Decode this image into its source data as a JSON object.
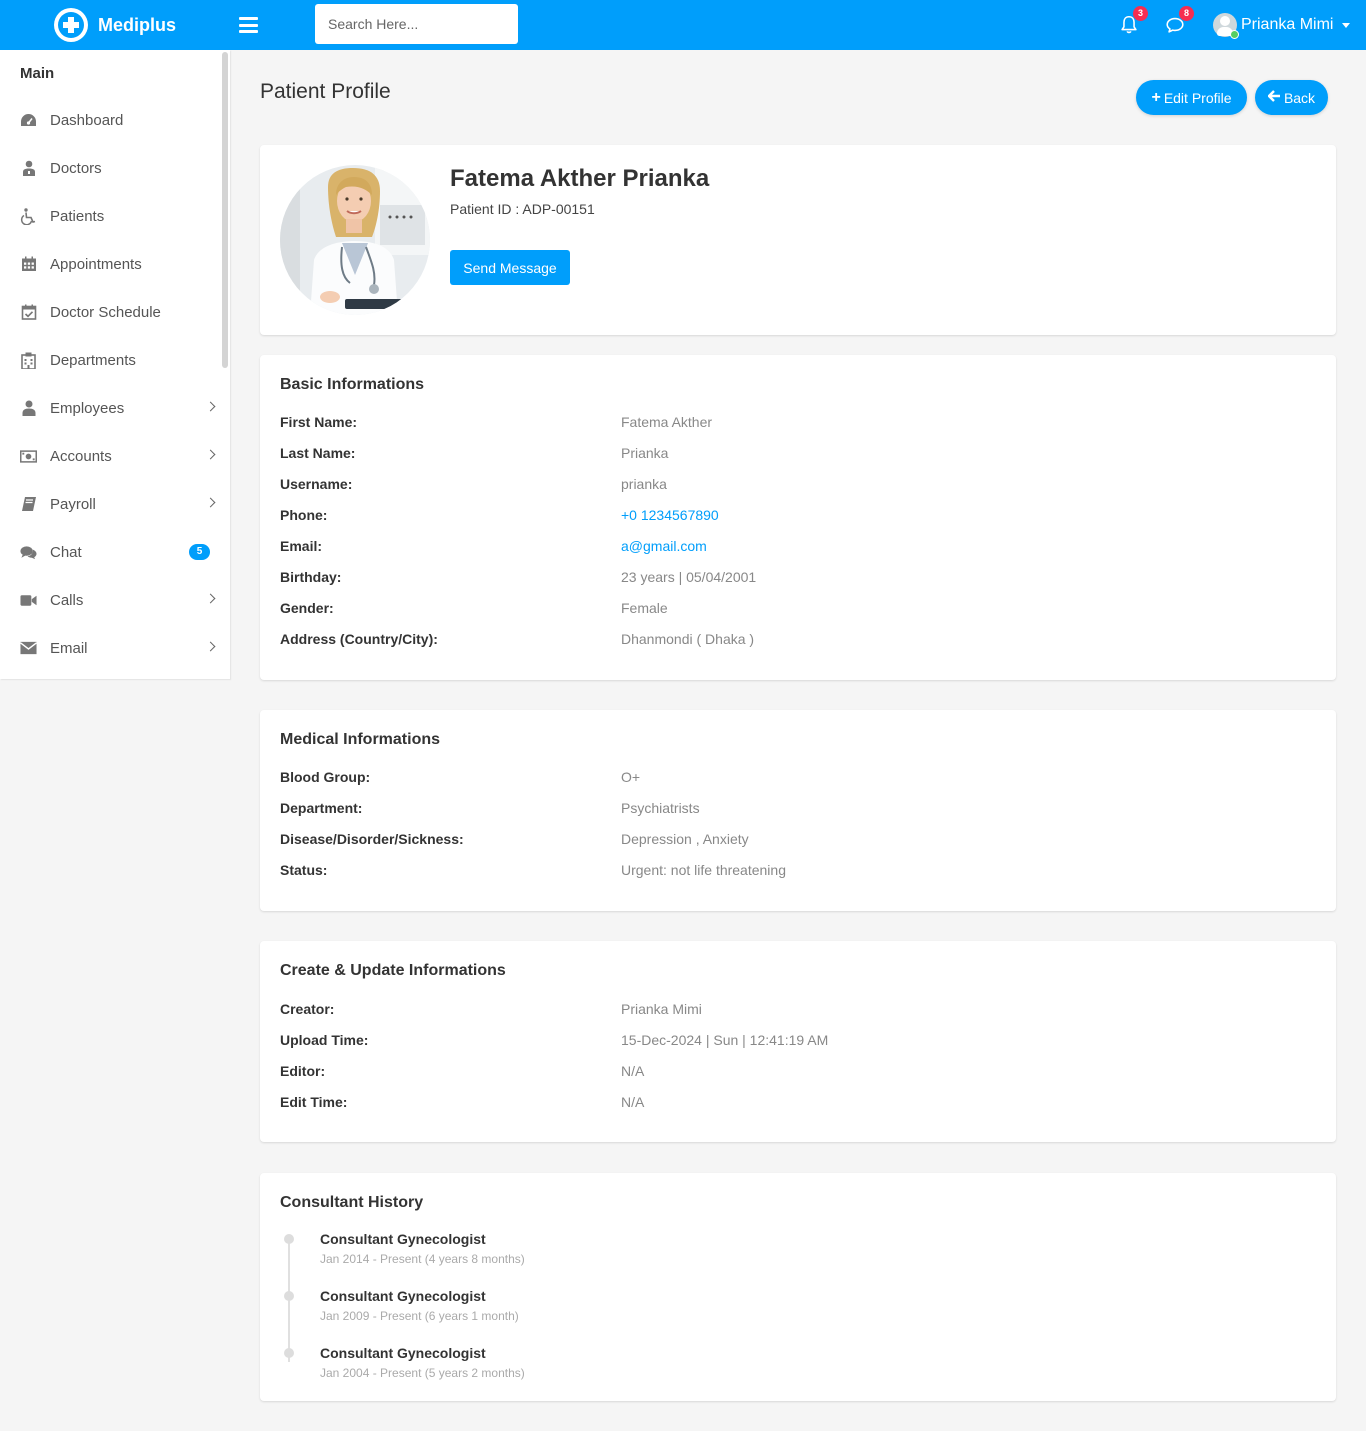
{
  "header": {
    "brand": "Mediplus",
    "search_placeholder": "Search Here...",
    "notifications_count": "3",
    "messages_count": "8",
    "user_name": "Prianka Mimi"
  },
  "sidebar": {
    "title": "Main",
    "items": [
      {
        "label": "Dashboard",
        "icon": "dashboard-icon"
      },
      {
        "label": "Doctors",
        "icon": "doctor-icon"
      },
      {
        "label": "Patients",
        "icon": "wheelchair-icon"
      },
      {
        "label": "Appointments",
        "icon": "calendar-icon"
      },
      {
        "label": "Doctor Schedule",
        "icon": "calendar-check-icon"
      },
      {
        "label": "Departments",
        "icon": "hospital-icon"
      },
      {
        "label": "Employees",
        "icon": "user-icon",
        "has_submenu": true
      },
      {
        "label": "Accounts",
        "icon": "money-icon",
        "has_submenu": true
      },
      {
        "label": "Payroll",
        "icon": "book-icon",
        "has_submenu": true
      },
      {
        "label": "Chat",
        "icon": "comments-icon",
        "badge": "5"
      },
      {
        "label": "Calls",
        "icon": "video-camera-icon",
        "has_submenu": true
      },
      {
        "label": "Email",
        "icon": "envelope-icon",
        "has_submenu": true
      }
    ]
  },
  "page": {
    "title": "Patient Profile",
    "edit_button": "Edit Profile",
    "back_button": "Back"
  },
  "profile": {
    "name": "Fatema Akther Prianka",
    "patient_id": "Patient ID : ADP-00151",
    "send_message": "Send Message"
  },
  "basic": {
    "title": "Basic Informations",
    "rows": [
      {
        "label": "First Name:",
        "value": "Fatema Akther"
      },
      {
        "label": "Last Name:",
        "value": "Prianka"
      },
      {
        "label": "Username:",
        "value": "prianka"
      },
      {
        "label": "Phone:",
        "value": "+0 1234567890"
      },
      {
        "label": "Email:",
        "value": "a@gmail.com"
      },
      {
        "label": "Birthday:",
        "value": "23 years | 05/04/2001"
      },
      {
        "label": "Gender:",
        "value": "Female"
      },
      {
        "label": "Address (Country/City):",
        "value": "Dhanmondi ( Dhaka )"
      }
    ]
  },
  "medical": {
    "title": "Medical Informations",
    "rows": [
      {
        "label": "Blood Group:",
        "value": "O+"
      },
      {
        "label": "Department:",
        "value": "Psychiatrists"
      },
      {
        "label": "Disease/Disorder/Sickness:",
        "value": "Depression , Anxiety"
      },
      {
        "label": "Status:",
        "value": "Urgent: not life threatening"
      }
    ]
  },
  "audit": {
    "title": "Create & Update Informations",
    "rows": [
      {
        "label": "Creator:",
        "value": "Prianka Mimi"
      },
      {
        "label": "Upload Time:",
        "value": "15-Dec-2024 | Sun | 12:41:19 AM"
      },
      {
        "label": "Editor:",
        "value": "N/A"
      },
      {
        "label": "Edit Time:",
        "value": "N/A"
      }
    ]
  },
  "history": {
    "title": "Consultant History",
    "items": [
      {
        "title": "Consultant Gynecologist",
        "period": "Jan 2014 - Present (4 years 8 months)"
      },
      {
        "title": "Consultant Gynecologist",
        "period": "Jan 2009 - Present (6 years 1 month)"
      },
      {
        "title": "Consultant Gynecologist",
        "period": "Jan 2004 - Present (5 years 2 months)"
      }
    ]
  },
  "colors": {
    "primary": "#009efb",
    "badge_red": "#f62d51",
    "online_green": "#55ce63"
  }
}
